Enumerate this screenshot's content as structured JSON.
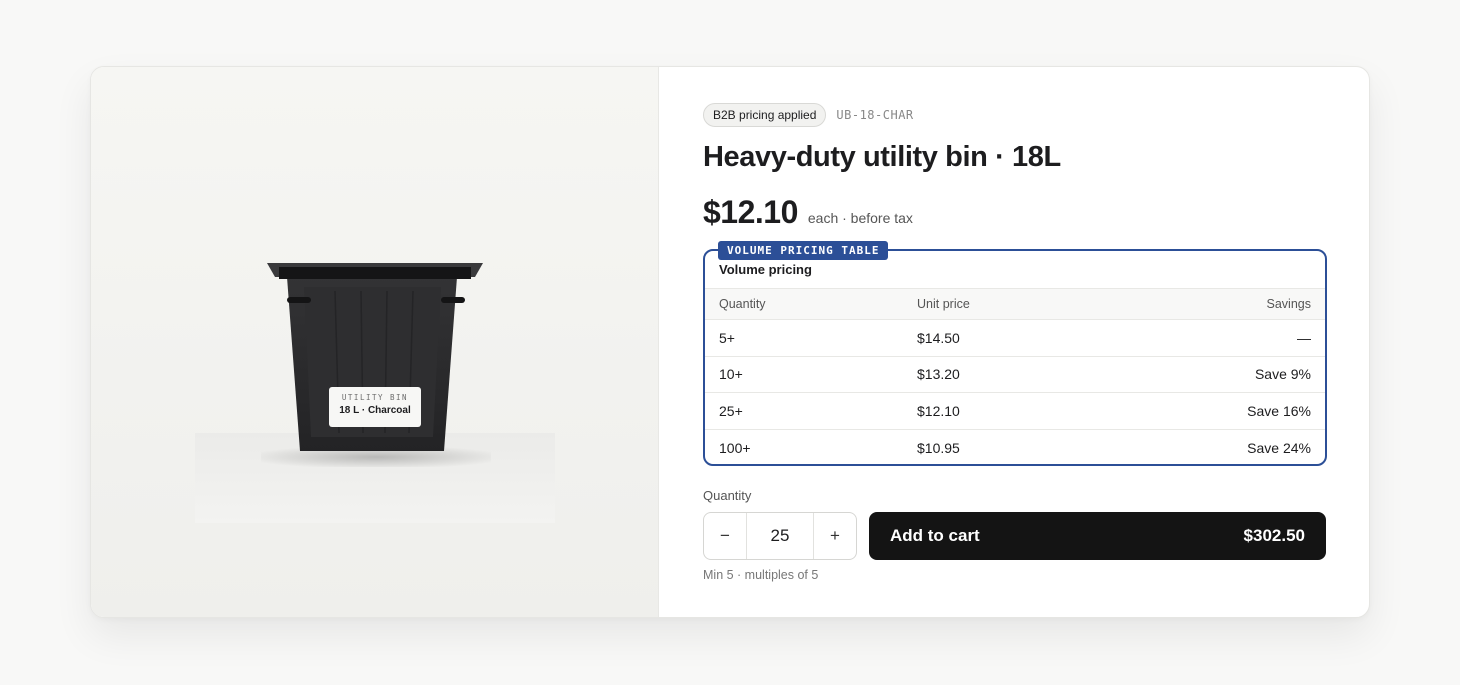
{
  "media": {
    "bin_label_line1": "UTILITY BIN",
    "bin_label_line2": "18 L · Charcoal"
  },
  "product": {
    "badge": "B2B pricing applied",
    "sku": "UB-18-CHAR",
    "title": "Heavy-duty utility bin · 18L",
    "price": "$12.10",
    "price_note": "each · before tax"
  },
  "volume_pricing": {
    "tag": "VOLUME PRICING TABLE",
    "heading": "Volume pricing",
    "columns": [
      "Quantity",
      "Unit price",
      "Savings"
    ],
    "rows": [
      [
        "5+",
        "$14.50",
        "—"
      ],
      [
        "10+",
        "$13.20",
        "Save 9%"
      ],
      [
        "25+",
        "$12.10",
        "Save 16%"
      ],
      [
        "100+",
        "$10.95",
        "Save 24%"
      ]
    ]
  },
  "purchase": {
    "quantity_label": "Quantity",
    "decrement": "−",
    "quantity": "25",
    "increment": "+",
    "cart_label": "Add to cart",
    "cart_total": "$302.50",
    "hint": "Min 5 · multiples of 5"
  },
  "colors": {
    "accent": "#2c4f97",
    "cart_button": "#141414",
    "bin": "#2a2a2c"
  }
}
